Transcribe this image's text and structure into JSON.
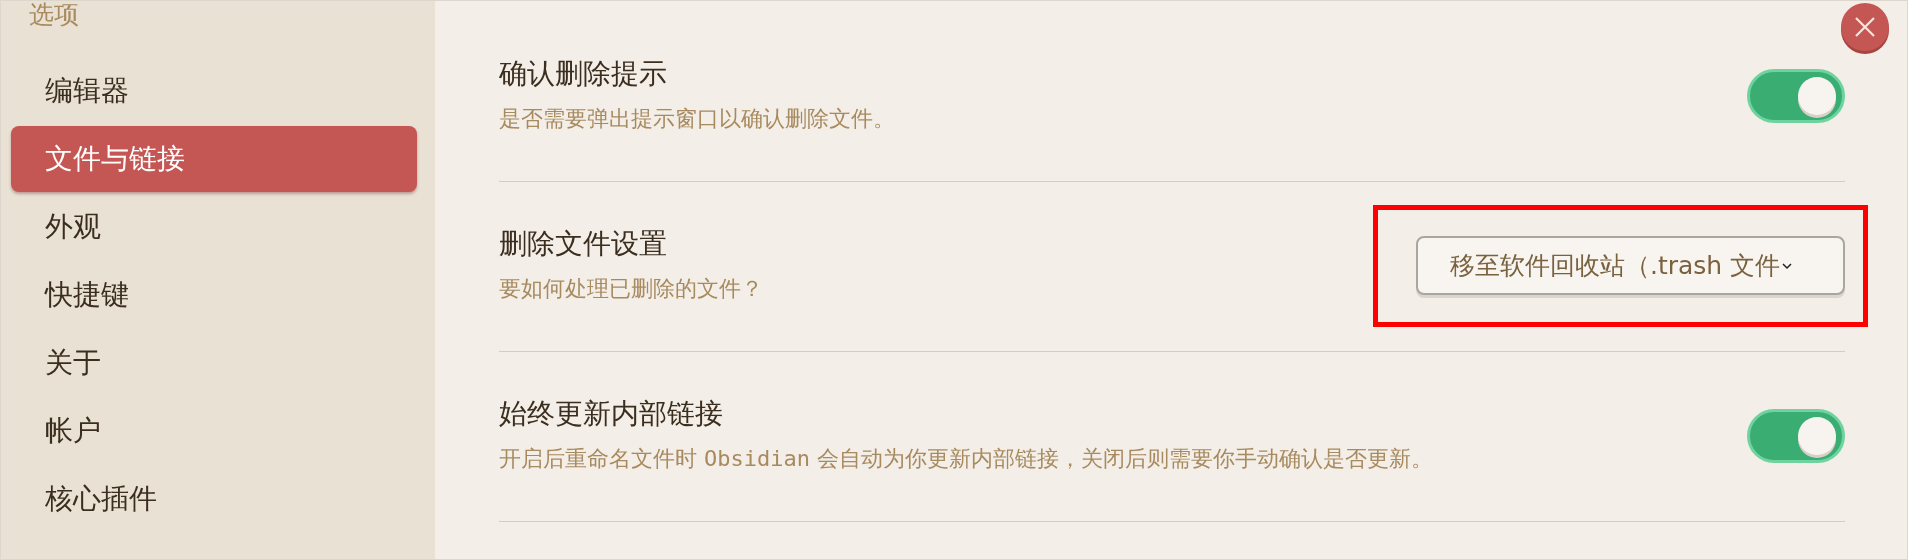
{
  "sidebar": {
    "title": "选项",
    "items": [
      {
        "label": "编辑器",
        "selected": false
      },
      {
        "label": "文件与链接",
        "selected": true
      },
      {
        "label": "外观",
        "selected": false
      },
      {
        "label": "快捷键",
        "selected": false
      },
      {
        "label": "关于",
        "selected": false
      },
      {
        "label": "帐户",
        "selected": false
      },
      {
        "label": "核心插件",
        "selected": false
      }
    ]
  },
  "settings": [
    {
      "title": "确认删除提示",
      "description": [
        {
          "kind": "text",
          "text": "是否需要弹出提示窗口以确认删除文件。"
        }
      ],
      "control": {
        "kind": "toggle",
        "on": true
      },
      "highlighted": false
    },
    {
      "title": "删除文件设置",
      "description": [
        {
          "kind": "text",
          "text": "要如何处理已删除的文件？"
        }
      ],
      "control": {
        "kind": "dropdown",
        "value": "移至软件回收站（.trash 文件"
      },
      "highlighted": true
    },
    {
      "title": "始终更新内部链接",
      "description": [
        {
          "kind": "text",
          "text": "开启后重命名文件时 "
        },
        {
          "kind": "code",
          "text": "Obsidian"
        },
        {
          "kind": "text",
          "text": " 会自动为你更新内部链接，关闭后则需要你手动确认是否更新。"
        }
      ],
      "control": {
        "kind": "toggle",
        "on": true
      },
      "highlighted": false
    }
  ]
}
